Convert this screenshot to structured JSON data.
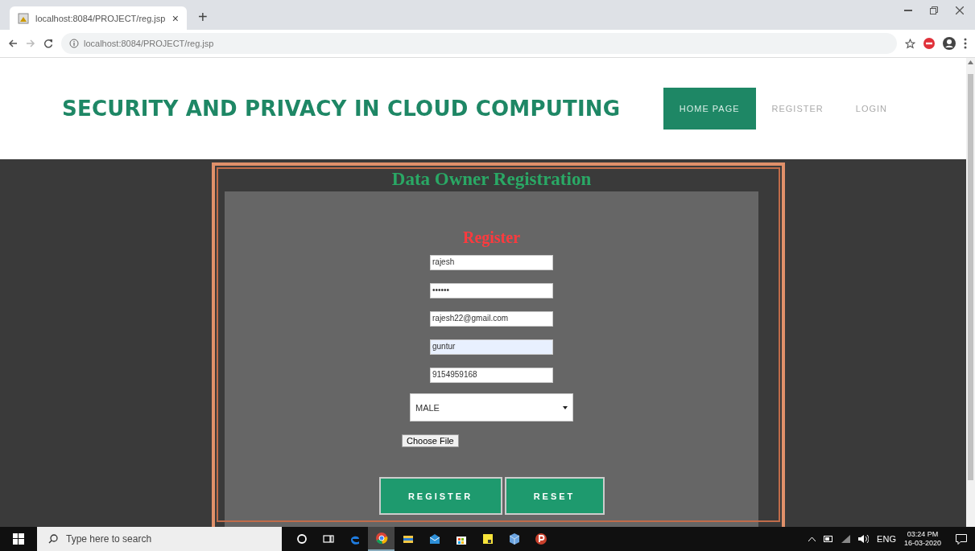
{
  "browser": {
    "tab": {
      "title": "localhost:8084/PROJECT/reg.jsp",
      "close": "×"
    },
    "new_tab": "+",
    "address": "localhost:8084/PROJECT/reg.jsp"
  },
  "header": {
    "title": "SECURITY AND PRIVACY IN CLOUD COMPUTING",
    "nav": [
      {
        "label": "HOME PAGE",
        "selected": true
      },
      {
        "label": "REGISTER",
        "selected": false
      },
      {
        "label": "LOGIN",
        "selected": false
      }
    ]
  },
  "form": {
    "title": "Data Owner Registration",
    "subtitle": "Register",
    "fields": [
      {
        "value": "rajesh",
        "autofilled": false
      },
      {
        "value": "••••••",
        "autofilled": false
      },
      {
        "value": "rajesh22@gmail.com",
        "autofilled": false
      },
      {
        "value": "guntur",
        "autofilled": true
      },
      {
        "value": "9154959168",
        "autofilled": false
      }
    ],
    "gender": "MALE",
    "file_button": "Choose File",
    "buttons": [
      "REGISTER",
      "RESET"
    ]
  },
  "taskbar": {
    "search_placeholder": "Type here to search",
    "apps": [
      {
        "kind": "cortana",
        "selected": false
      },
      {
        "kind": "taskview",
        "selected": false
      },
      {
        "kind": "edge",
        "selected": false
      },
      {
        "kind": "chrome",
        "selected": true
      },
      {
        "kind": "explorer",
        "selected": false
      },
      {
        "kind": "mail",
        "selected": false
      },
      {
        "kind": "store",
        "selected": false
      },
      {
        "kind": "notes",
        "selected": false
      },
      {
        "kind": "box",
        "selected": false
      },
      {
        "kind": "p",
        "selected": false
      }
    ],
    "language": "ENG",
    "time": "03:24 PM",
    "date": "16-03-2020"
  }
}
